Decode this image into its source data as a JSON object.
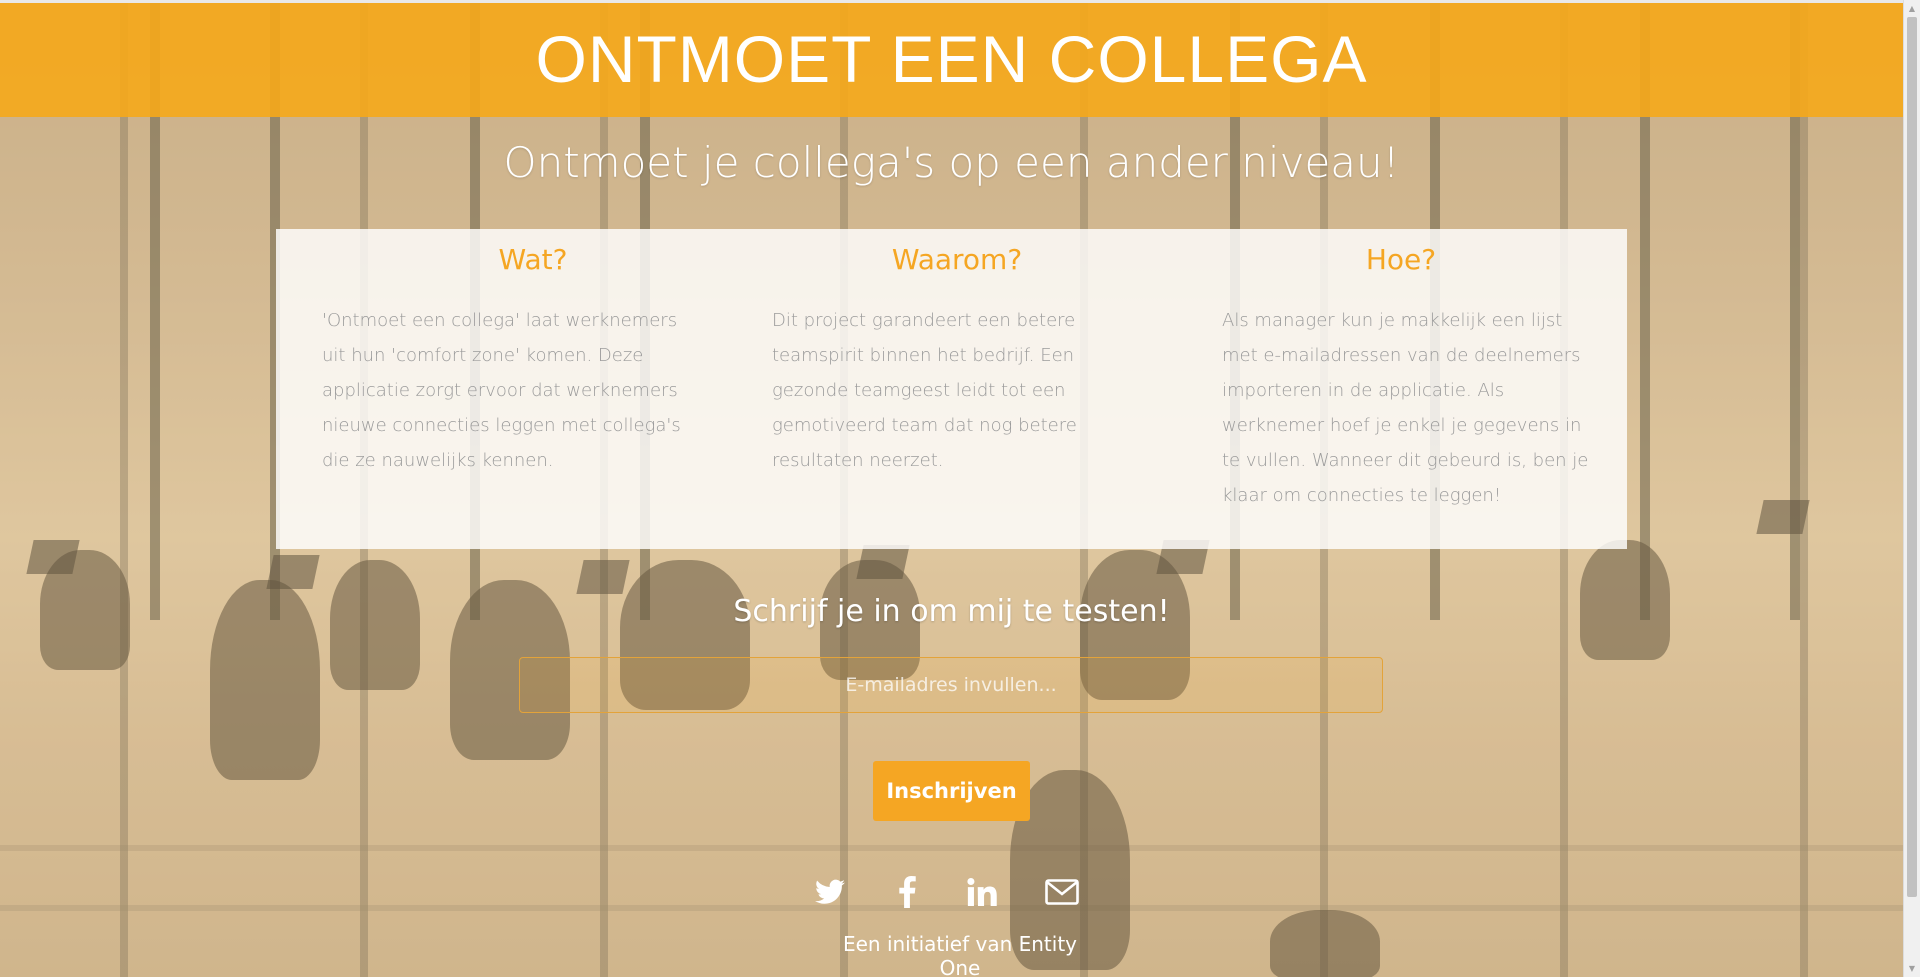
{
  "header": {
    "title": "ONTMOET EEN COLLEGA"
  },
  "hero": {
    "subtitle": "Ontmoet je collega's op een ander niveau!"
  },
  "sections": [
    {
      "title": "Wat?",
      "text": "'Ontmoet een collega' laat werknemers uit hun 'comfort zone' komen. Deze applicatie zorgt ervoor dat werknemers nieuwe connecties leggen met collega's die ze nauwelijks kennen."
    },
    {
      "title": "Waarom?",
      "text": "Dit project garandeert een betere teamspirit binnen het bedrijf. Een gezonde teamgeest leidt tot een gemotiveerd team dat nog betere resultaten neerzet."
    },
    {
      "title": "Hoe?",
      "text": "Als manager kun je makkelijk een lijst met e-mailadressen van de deelnemers importeren in de applicatie. Als werknemer hoef je enkel je gegevens in te vullen. Wanneer dit gebeurd is, ben je klaar om connecties te leggen!"
    }
  ],
  "signup": {
    "title": "Schrijf je in om mij te testen!",
    "email_placeholder": "E-mailadres invullen...",
    "email_value": "",
    "button_label": "Inschrijven"
  },
  "social": {
    "icons": [
      "twitter-icon",
      "facebook-icon",
      "linkedin-icon",
      "mail-icon"
    ]
  },
  "footer": {
    "text": "Een initiatief van Entity One"
  },
  "colors": {
    "accent": "#f5a623",
    "header_band": "#f6a81a",
    "body_text": "#9b9b9b",
    "white": "#ffffff"
  }
}
